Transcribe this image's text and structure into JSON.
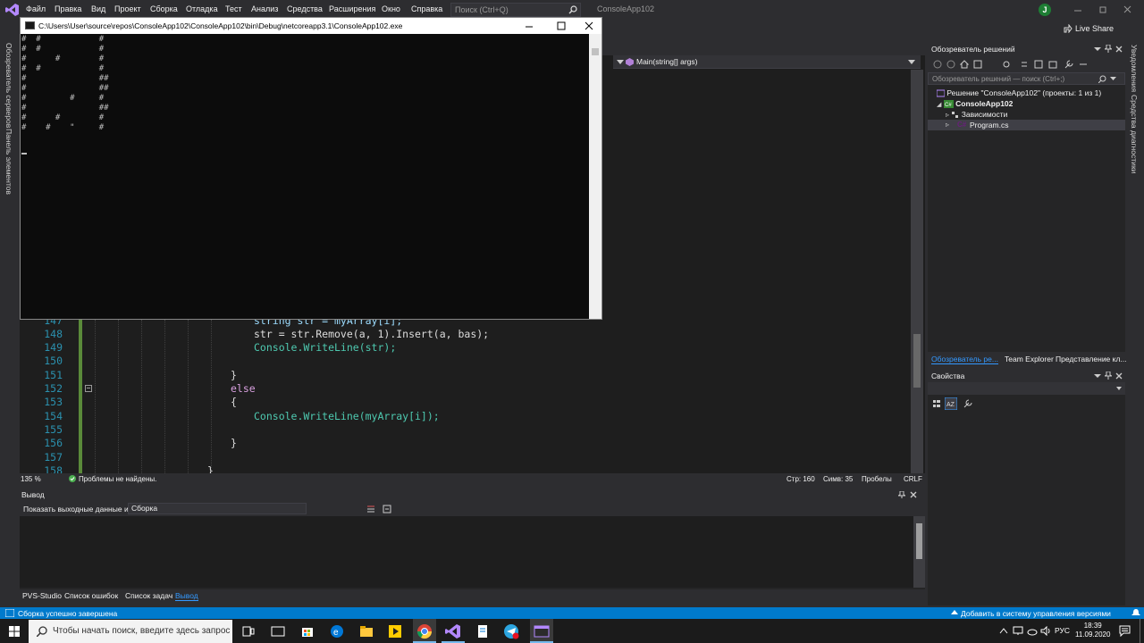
{
  "menu": {
    "items": [
      "Файл",
      "Правка",
      "Вид",
      "Проект",
      "Сборка",
      "Отладка",
      "Тест",
      "Анализ",
      "Средства",
      "Расширения",
      "Окно",
      "Справка"
    ],
    "search_placeholder": "Поиск (Ctrl+Q)",
    "solution_name": "ConsoleApp102",
    "user_initial": "J",
    "live_share": "Live Share"
  },
  "left_tabs": [
    "Обозреватель серверов",
    "Панель элементов"
  ],
  "right_tabs": [
    "Уведомления",
    "Средства диагностики"
  ],
  "console": {
    "title": "C:\\Users\\User\\source\\repos\\ConsoleApp102\\ConsoleApp102\\bin\\Debug\\netcoreapp3.1\\ConsoleApp102.exe",
    "lines": [
      "#  #            #",
      "#  #            #",
      "#      #        #",
      "#  #            #",
      "#               ##",
      "#               ##",
      "#         #     #",
      "#               ##",
      "#      #        #",
      "#    #    \"     #"
    ]
  },
  "editor": {
    "nav_method": "Main(string[] args)",
    "lines": [
      {
        "num": "147",
        "code": "string str = myArray[i];"
      },
      {
        "num": "148",
        "code": "str = str.Remove(a, 1).Insert(a, bas);"
      },
      {
        "num": "149",
        "code": "Console.WriteLine(str);"
      },
      {
        "num": "150",
        "code": ""
      },
      {
        "num": "151",
        "code": "}"
      },
      {
        "num": "152",
        "code": "else"
      },
      {
        "num": "153",
        "code": "{"
      },
      {
        "num": "154",
        "code": "Console.WriteLine(myArray[i]);"
      },
      {
        "num": "155",
        "code": ""
      },
      {
        "num": "156",
        "code": "}"
      },
      {
        "num": "157",
        "code": ""
      },
      {
        "num": "158",
        "code": "}"
      }
    ]
  },
  "editor_status": {
    "zoom": "135 %",
    "issues": "Проблемы не найдены.",
    "line": "Стр: 160",
    "column": "Симв: 35",
    "whitespace": "Пробелы",
    "line_ending": "CRLF"
  },
  "output": {
    "title": "Вывод",
    "show_from_label": "Показать выходные данные из:",
    "show_from_value": "Сборка"
  },
  "bottom_tabs": [
    "PVS-Studio",
    "Список ошибок",
    "Список задач",
    "Вывод"
  ],
  "solution_explorer": {
    "title": "Обозреватель решений",
    "search_placeholder": "Обозреватель решений — поиск (Ctrl+;)",
    "solution": "Решение \"ConsoleApp102\" (проекты: 1 из 1)",
    "project": "ConsoleApp102",
    "dependencies": "Зависимости",
    "file": "Program.cs",
    "tabs": [
      "Обозреватель ре...",
      "Team Explorer",
      "Представление кл..."
    ]
  },
  "properties": {
    "title": "Свойства"
  },
  "statusbar": {
    "message": "Сборка успешно завершена",
    "source_control": "Добавить в систему управления версиями"
  },
  "taskbar": {
    "search_placeholder": "Чтобы начать поиск, введите здесь запрос",
    "lang": "РУС",
    "time": "18:39",
    "date": "11.09.2020"
  },
  "colors": {
    "accent": "#007acc",
    "keyword": "#c586c0",
    "class": "#4ec9b0",
    "method": "#dcdcaa",
    "variable": "#9cdcfe",
    "ln": "#2b91af"
  }
}
